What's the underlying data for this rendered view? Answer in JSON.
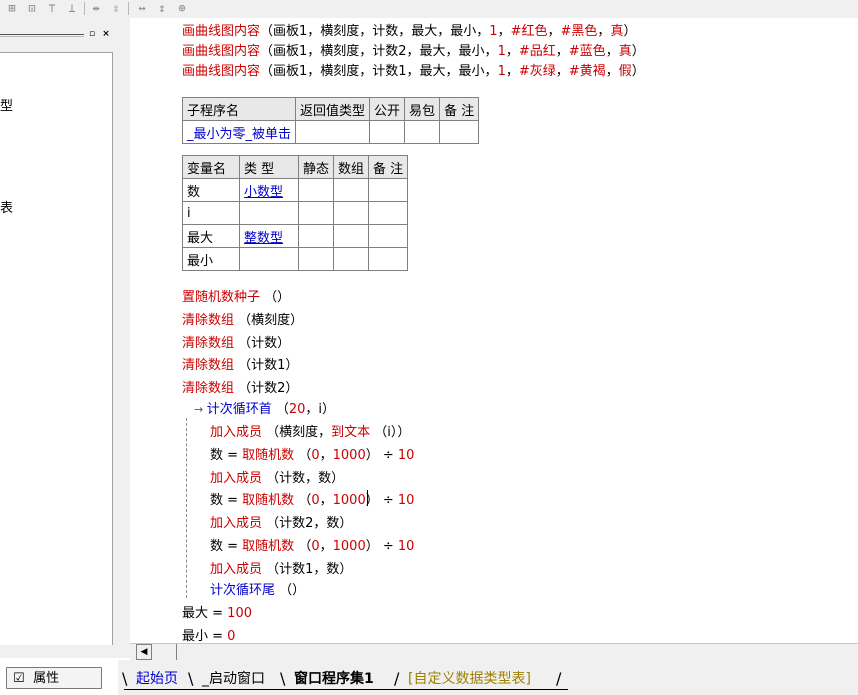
{
  "toolbar": {
    "buttons": [
      "align-left-icon",
      "align-center-icon",
      "align-right-icon",
      "distribute-icon",
      "space-horizontal-icon",
      "space-vertical-icon",
      "same-width-icon",
      "same-height-icon",
      "same-size-icon"
    ]
  },
  "left_panel": {
    "controls": {
      "restore": "▫",
      "close": "×"
    },
    "fragments": [
      "型",
      "表"
    ]
  },
  "code": {
    "draw_lines": [
      {
        "cmd": "画曲线图内容",
        "args": [
          {
            "t": "（画板1，横刻度，计数，最大，最小，",
            "c": "blk"
          },
          {
            "t": "1",
            "c": "red"
          },
          {
            "t": "，",
            "c": "blk"
          },
          {
            "t": "#红色",
            "c": "red"
          },
          {
            "t": "，",
            "c": "blk"
          },
          {
            "t": "#黑色",
            "c": "red"
          },
          {
            "t": "，",
            "c": "blk"
          },
          {
            "t": "真",
            "c": "red"
          },
          {
            "t": "）",
            "c": "blk"
          }
        ]
      },
      {
        "cmd": "画曲线图内容",
        "args": [
          {
            "t": "（画板1，横刻度，计数2，最大，最小，",
            "c": "blk"
          },
          {
            "t": "1",
            "c": "red"
          },
          {
            "t": "，",
            "c": "blk"
          },
          {
            "t": "#品红",
            "c": "red"
          },
          {
            "t": "，",
            "c": "blk"
          },
          {
            "t": "#蓝色",
            "c": "red"
          },
          {
            "t": "，",
            "c": "blk"
          },
          {
            "t": "真",
            "c": "red"
          },
          {
            "t": "）",
            "c": "blk"
          }
        ]
      },
      {
        "cmd": "画曲线图内容",
        "args": [
          {
            "t": "（画板1，横刻度，计数1，最大，最小，",
            "c": "blk"
          },
          {
            "t": "1",
            "c": "red"
          },
          {
            "t": "，",
            "c": "blk"
          },
          {
            "t": "#灰绿",
            "c": "red"
          },
          {
            "t": "，",
            "c": "blk"
          },
          {
            "t": "#黄褐",
            "c": "red"
          },
          {
            "t": "，",
            "c": "blk"
          },
          {
            "t": "假",
            "c": "red"
          },
          {
            "t": "）",
            "c": "blk"
          }
        ]
      }
    ],
    "sub_table": {
      "headers": [
        "子程序名",
        "返回值类型",
        "公开",
        "易包",
        "备 注"
      ],
      "row": [
        "_最小为零_被单击",
        "",
        "",
        "",
        ""
      ]
    },
    "var_table": {
      "headers": [
        "变量名",
        "类 型",
        "静态",
        "数组",
        "备 注"
      ],
      "rows": [
        [
          "数",
          "小数型",
          "",
          "",
          ""
        ],
        [
          "i",
          "",
          "",
          "",
          ""
        ],
        [
          "最大",
          "整数型",
          "",
          "",
          ""
        ],
        [
          "最小",
          "",
          "",
          "",
          ""
        ]
      ]
    },
    "statements": [
      [
        {
          "t": "置随机数种子",
          "c": "red"
        },
        {
          "t": " （）",
          "c": "blk"
        }
      ],
      [
        {
          "t": "清除数组",
          "c": "red"
        },
        {
          "t": " （横刻度）",
          "c": "blk"
        }
      ],
      [
        {
          "t": "清除数组",
          "c": "red"
        },
        {
          "t": " （计数）",
          "c": "blk"
        }
      ],
      [
        {
          "t": "清除数组",
          "c": "red"
        },
        {
          "t": " （计数1）",
          "c": "blk"
        }
      ],
      [
        {
          "t": "清除数组",
          "c": "red"
        },
        {
          "t": " （计数2）",
          "c": "blk"
        }
      ]
    ],
    "loop_head": [
      {
        "t": "计次循环首",
        "c": "blue"
      },
      {
        "t": " （",
        "c": "blk"
      },
      {
        "t": "20",
        "c": "red"
      },
      {
        "t": "，i）",
        "c": "blk"
      }
    ],
    "loop_body": [
      [
        {
          "t": "加入成员",
          "c": "red"
        },
        {
          "t": " （横刻度，",
          "c": "blk"
        },
        {
          "t": "到文本",
          "c": "red"
        },
        {
          "t": " （i））",
          "c": "blk"
        }
      ],
      [
        {
          "t": "数 = ",
          "c": "blk"
        },
        {
          "t": "取随机数",
          "c": "red"
        },
        {
          "t": " （",
          "c": "blk"
        },
        {
          "t": "0",
          "c": "red"
        },
        {
          "t": "，",
          "c": "blk"
        },
        {
          "t": "1000",
          "c": "red"
        },
        {
          "t": "） ÷ ",
          "c": "blk"
        },
        {
          "t": "10",
          "c": "red"
        }
      ],
      [
        {
          "t": "加入成员",
          "c": "red"
        },
        {
          "t": " （计数，数）",
          "c": "blk"
        }
      ],
      [
        {
          "t": "数 = ",
          "c": "blk"
        },
        {
          "t": "取随机数",
          "c": "red"
        },
        {
          "t": " （",
          "c": "blk"
        },
        {
          "t": "0",
          "c": "red"
        },
        {
          "t": "，",
          "c": "blk"
        },
        {
          "t": "1000",
          "c": "red"
        },
        {
          "t": "） ÷ ",
          "c": "blk"
        },
        {
          "t": "10",
          "c": "red"
        }
      ],
      [
        {
          "t": "加入成员",
          "c": "red"
        },
        {
          "t": " （计数2，数）",
          "c": "blk"
        }
      ],
      [
        {
          "t": "数 = ",
          "c": "blk"
        },
        {
          "t": "取随机数",
          "c": "red"
        },
        {
          "t": " （",
          "c": "blk"
        },
        {
          "t": "0",
          "c": "red"
        },
        {
          "t": "，",
          "c": "blk"
        },
        {
          "t": "1000",
          "c": "red"
        },
        {
          "t": "） ÷ ",
          "c": "blk"
        },
        {
          "t": "10",
          "c": "red"
        }
      ],
      [
        {
          "t": "加入成员",
          "c": "red"
        },
        {
          "t": " （计数1，数）",
          "c": "blk"
        }
      ]
    ],
    "loop_tail": [
      {
        "t": "计次循环尾",
        "c": "blue"
      },
      {
        "t": " （）",
        "c": "blk"
      }
    ],
    "after": [
      [
        {
          "t": "最大 = ",
          "c": "blk"
        },
        {
          "t": "100",
          "c": "red"
        }
      ],
      [
        {
          "t": "最小 = ",
          "c": "blk"
        },
        {
          "t": "0",
          "c": "red"
        }
      ]
    ]
  },
  "gutter": {
    "arrow": "↓",
    "plus": "+"
  },
  "loop_arrow": "→",
  "properties_tab": {
    "label": "属性"
  },
  "tabs": [
    {
      "label": "起始页",
      "color": "#0000cc"
    },
    {
      "label": "_启动窗口",
      "color": "#000000"
    },
    {
      "label": "窗口程序集1",
      "color": "#000000",
      "active": true
    },
    {
      "label": "[自定义数据类型表]",
      "color": "#a08000"
    }
  ],
  "colors": {
    "keyword": "#cc0000",
    "flow": "#0000cc",
    "type": "#0000cc",
    "panel": "#f0f0f0"
  }
}
